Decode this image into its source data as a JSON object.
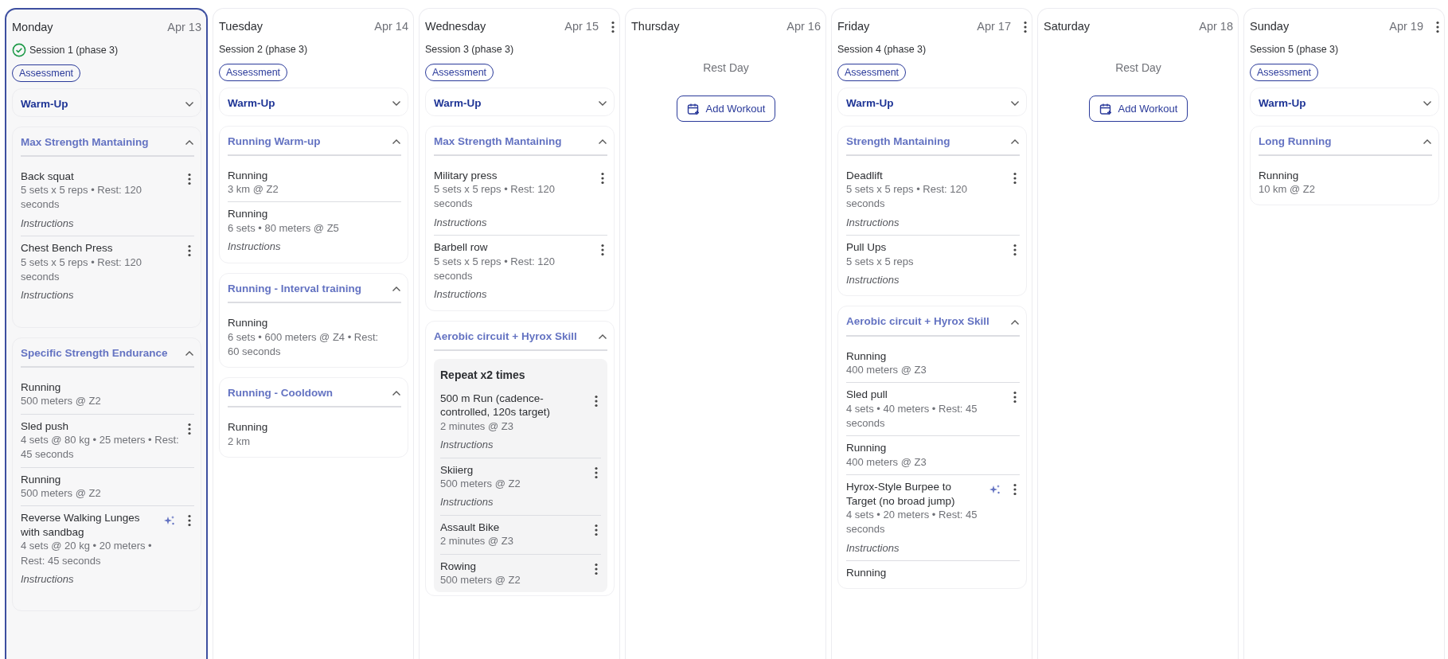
{
  "days": [
    {
      "name": "Monday",
      "date": "Apr 13",
      "selected": true,
      "completed": true,
      "menu": false,
      "session": "Session 1 (phase 3)",
      "tag": "Assessment",
      "blocks": [
        {
          "title": "Warm-Up",
          "expanded": false
        },
        {
          "title": "Max Strength Mantaining",
          "expanded": true,
          "items": [
            {
              "kind": "exercise",
              "name": "Back squat",
              "detail": "5 sets x 5 reps • Rest: 120 seconds",
              "instructions": "Instructions",
              "menu": true,
              "ai": false
            },
            {
              "kind": "exercise",
              "name": "Chest Bench Press",
              "detail": "5 sets x 5 reps • Rest: 120 seconds",
              "instructions": "Instructions",
              "menu": true,
              "ai": false
            }
          ]
        },
        {
          "title": "Specific Strength Endurance",
          "expanded": true,
          "items": [
            {
              "kind": "exercise",
              "name": "Running",
              "detail": "500 meters @ Z2",
              "menu": false,
              "ai": false
            },
            {
              "kind": "exercise",
              "name": "Sled push",
              "detail": "4 sets @ 80 kg • 25 meters • Rest: 45 seconds",
              "menu": true,
              "ai": false
            },
            {
              "kind": "exercise",
              "name": "Running",
              "detail": "500 meters @ Z2",
              "menu": false,
              "ai": false
            },
            {
              "kind": "exercise",
              "name": "Reverse Walking Lunges with sandbag",
              "detail": "4 sets @ 20 kg • 20 meters • Rest: 45 seconds",
              "instructions": "Instructions",
              "menu": true,
              "ai": true
            }
          ]
        }
      ]
    },
    {
      "name": "Tuesday",
      "date": "Apr 14",
      "selected": false,
      "completed": false,
      "menu": false,
      "session": "Session 2 (phase 3)",
      "tag": "Assessment",
      "blocks": [
        {
          "title": "Warm-Up",
          "expanded": false
        },
        {
          "title": "Running Warm-up",
          "expanded": true,
          "items": [
            {
              "kind": "exercise",
              "name": "Running",
              "detail": "3 km @ Z2",
              "menu": false,
              "ai": false
            },
            {
              "kind": "exercise",
              "name": "Running",
              "detail": "6 sets • 80 meters @ Z5",
              "instructions": "Instructions",
              "menu": false,
              "ai": false
            }
          ]
        },
        {
          "title": "Running - Interval training",
          "expanded": true,
          "items": [
            {
              "kind": "exercise",
              "name": "Running",
              "detail": "6 sets • 600 meters @ Z4 • Rest: 60 seconds",
              "menu": false,
              "ai": false
            }
          ]
        },
        {
          "title": "Running - Cooldown",
          "expanded": true,
          "items": [
            {
              "kind": "exercise",
              "name": "Running",
              "detail": "2 km",
              "menu": false,
              "ai": false
            }
          ]
        }
      ]
    },
    {
      "name": "Wednesday",
      "date": "Apr 15",
      "selected": false,
      "completed": false,
      "menu": true,
      "session": "Session 3 (phase 3)",
      "tag": "Assessment",
      "blocks": [
        {
          "title": "Warm-Up",
          "expanded": false
        },
        {
          "title": "Max Strength Mantaining",
          "expanded": true,
          "items": [
            {
              "kind": "exercise",
              "name": "Military press",
              "detail": "5 sets x 5 reps • Rest: 120 seconds",
              "instructions": "Instructions",
              "menu": true,
              "ai": false
            },
            {
              "kind": "exercise",
              "name": "Barbell row",
              "detail": "5 sets x 5 reps • Rest: 120 seconds",
              "instructions": "Instructions",
              "menu": true,
              "ai": false
            }
          ]
        },
        {
          "title": "Aerobic circuit + Hyrox Skill",
          "expanded": true,
          "items": [
            {
              "kind": "repeat",
              "title": "Repeat x2 times",
              "items": [
                {
                  "kind": "exercise",
                  "name": "500 m Run (cadence-controlled, 120s target)",
                  "detail": "2 minutes @ Z3",
                  "instructions": "Instructions",
                  "menu": true,
                  "ai": false
                },
                {
                  "kind": "exercise",
                  "name": "Skiierg",
                  "detail": "500 meters @ Z2",
                  "instructions": "Instructions",
                  "menu": true,
                  "ai": false
                },
                {
                  "kind": "exercise",
                  "name": "Assault Bike",
                  "detail": "2 minutes @ Z3",
                  "menu": true,
                  "ai": false
                },
                {
                  "kind": "exercise",
                  "name": "Rowing",
                  "detail": "500 meters @ Z2",
                  "menu": true,
                  "ai": false
                }
              ]
            }
          ]
        }
      ]
    },
    {
      "name": "Thursday",
      "date": "Apr 16",
      "selected": false,
      "completed": false,
      "menu": false,
      "rest": "Rest Day",
      "add_button": "Add Workout"
    },
    {
      "name": "Friday",
      "date": "Apr 17",
      "selected": false,
      "completed": false,
      "menu": true,
      "session": "Session 4 (phase 3)",
      "tag": "Assessment",
      "blocks": [
        {
          "title": "Warm-Up",
          "expanded": false
        },
        {
          "title": "Strength Mantaining",
          "expanded": true,
          "items": [
            {
              "kind": "exercise",
              "name": "Deadlift",
              "detail": "5 sets x 5 reps • Rest: 120 seconds",
              "instructions": "Instructions",
              "menu": true,
              "ai": false
            },
            {
              "kind": "exercise",
              "name": "Pull Ups",
              "detail": "5 sets x 5 reps",
              "instructions": "Instructions",
              "menu": true,
              "ai": false
            }
          ]
        },
        {
          "title": "Aerobic circuit + Hyrox Skill",
          "expanded": true,
          "items": [
            {
              "kind": "exercise",
              "name": "Running",
              "detail": "400 meters @ Z3",
              "menu": false,
              "ai": false
            },
            {
              "kind": "exercise",
              "name": "Sled pull",
              "detail": "4 sets • 40 meters • Rest: 45 seconds",
              "menu": true,
              "ai": false
            },
            {
              "kind": "exercise",
              "name": "Running",
              "detail": "400 meters @ Z3",
              "menu": false,
              "ai": false
            },
            {
              "kind": "exercise",
              "name": "Hyrox-Style Burpee to Target (no broad jump)",
              "detail": "4 sets • 20 meters • Rest: 45 seconds",
              "instructions": "Instructions",
              "menu": true,
              "ai": true
            },
            {
              "kind": "exercise",
              "name": "Running",
              "menu": false,
              "ai": false
            }
          ]
        }
      ]
    },
    {
      "name": "Saturday",
      "date": "Apr 18",
      "selected": false,
      "completed": false,
      "menu": false,
      "rest": "Rest Day",
      "add_button": "Add Workout"
    },
    {
      "name": "Sunday",
      "date": "Apr 19",
      "selected": false,
      "completed": false,
      "menu": true,
      "session": "Session 5 (phase 3)",
      "tag": "Assessment",
      "blocks": [
        {
          "title": "Warm-Up",
          "expanded": false
        },
        {
          "title": "Long Running",
          "expanded": true,
          "items": [
            {
              "kind": "exercise",
              "name": "Running",
              "detail": "10 km @ Z2",
              "menu": false,
              "ai": false
            }
          ]
        }
      ]
    }
  ]
}
